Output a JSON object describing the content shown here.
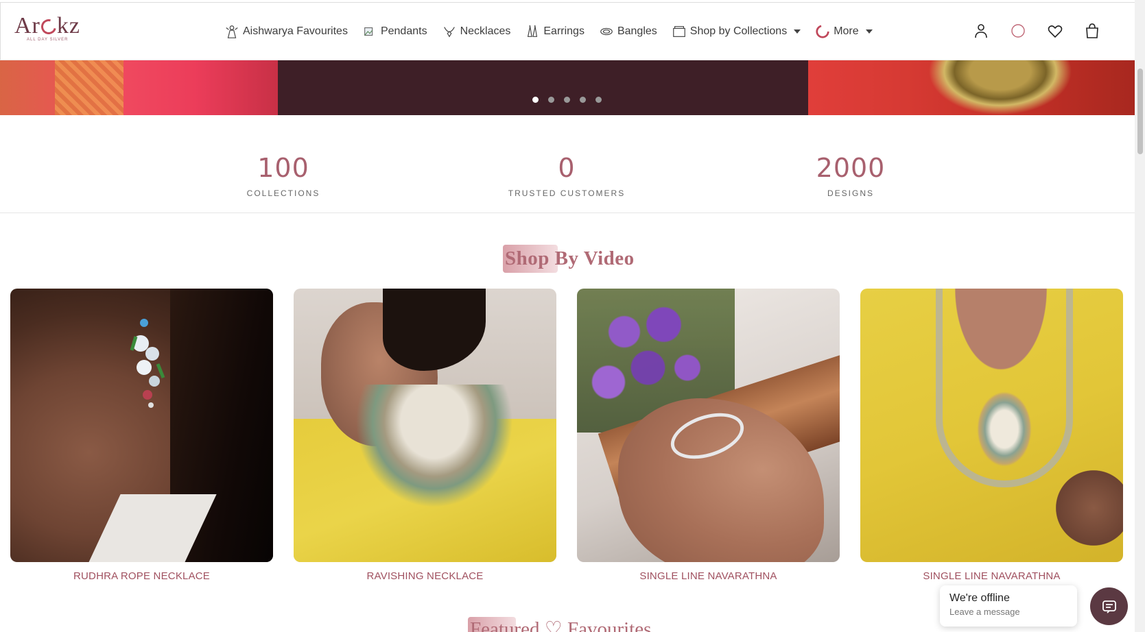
{
  "brand": {
    "logo_text_a": "Ar",
    "logo_text_b": "kz",
    "tagline": "ALL DAY SILVER"
  },
  "nav": {
    "items": [
      {
        "label": "Aishwarya Favourites",
        "icon": "lady-icon"
      },
      {
        "label": "Pendants",
        "icon": "pendant-icon"
      },
      {
        "label": "Necklaces",
        "icon": "necklace-icon"
      },
      {
        "label": "Earrings",
        "icon": "earrings-icon"
      },
      {
        "label": "Bangles",
        "icon": "bangle-icon"
      },
      {
        "label": "Shop by Collections",
        "icon": "box-icon",
        "dropdown": true
      },
      {
        "label": "More",
        "icon": "more-logo-icon",
        "dropdown": true
      }
    ]
  },
  "header_icons": [
    "user-icon",
    "search-icon",
    "heart-icon",
    "bag-icon"
  ],
  "hero": {
    "slide_count": 5,
    "active_slide": 1
  },
  "stats": [
    {
      "value": "100",
      "label": "COLLECTIONS"
    },
    {
      "value": "0",
      "label": "TRUSTED CUSTOMERS"
    },
    {
      "value": "2000",
      "label": "DESIGNS"
    }
  ],
  "shop_by_video": {
    "title": "Shop By Video",
    "items": [
      {
        "label": "RUDHRA ROPE NECKLACE"
      },
      {
        "label": "RAVISHING NECKLACE"
      },
      {
        "label": "SINGLE LINE NAVARATHNA"
      },
      {
        "label": "SINGLE LINE NAVARATHNA"
      }
    ]
  },
  "featured": {
    "title": "Featured ♡ Favourites"
  },
  "chat": {
    "title": "We're offline",
    "subtitle": "Leave a message"
  },
  "colors": {
    "accent": "#a8606e",
    "brand_dark": "#6e3a47",
    "chat_button": "#5b3942"
  }
}
